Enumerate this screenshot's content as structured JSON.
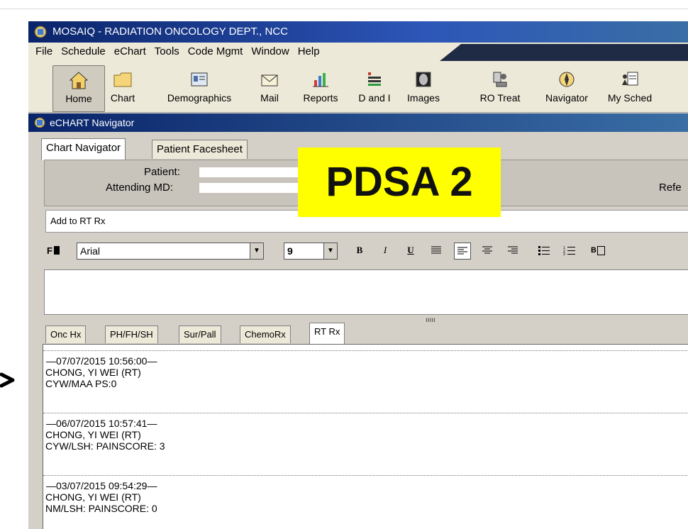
{
  "app": {
    "title": "MOSAIQ - RADIATION ONCOLOGY DEPT., NCC",
    "menu": [
      "File",
      "Schedule",
      "eChart",
      "Tools",
      "Code Mgmt",
      "Window",
      "Help"
    ]
  },
  "toolbar": {
    "items": [
      {
        "label": "Home",
        "icon": "home-icon"
      },
      {
        "label": "Chart",
        "icon": "folder-icon"
      },
      {
        "label": "Demographics",
        "icon": "id-card-icon"
      },
      {
        "label": "Mail",
        "icon": "mail-icon"
      },
      {
        "label": "Reports",
        "icon": "reports-icon"
      },
      {
        "label": "D and I",
        "icon": "d-and-i-icon"
      },
      {
        "label": "Images",
        "icon": "images-icon"
      },
      {
        "label": "RO Treat",
        "icon": "ro-treat-icon"
      },
      {
        "label": "Navigator",
        "icon": "navigator-icon"
      },
      {
        "label": "My Sched",
        "icon": "my-sched-icon"
      }
    ]
  },
  "navigator": {
    "title": "eCHART Navigator",
    "tabs": [
      "Chart Navigator",
      "Patient Facesheet"
    ],
    "patient_label": "Patient:",
    "attending_label": "Attending MD:",
    "referring_label": "Refe"
  },
  "editor": {
    "add_to_label": "Add to RT Rx",
    "font_style_button": "F",
    "font_name": "Arial",
    "font_size": "9",
    "format_buttons": [
      "bold-icon",
      "italic-icon",
      "underline-icon",
      "justify-icon",
      "align-left-icon",
      "align-center-icon",
      "align-right-icon",
      "bullet-list-icon",
      "numbered-list-icon",
      "border-icon"
    ]
  },
  "section_tabs": [
    "Onc Hx",
    "PH/FH/SH",
    "Sur/Pall",
    "ChemoRx",
    "RT Rx"
  ],
  "notes": [
    {
      "header": "—07/07/2015 10:56:00—",
      "author": "CHONG, YI WEI (RT)",
      "text": "CYW/MAA PS:0"
    },
    {
      "header": "—06/07/2015 10:57:41—",
      "author": "CHONG, YI WEI (RT)",
      "text": "CYW/LSH: PAINSCORE: 3"
    },
    {
      "header": "—03/07/2015 09:54:29—",
      "author": "CHONG, YI WEI (RT)",
      "text": "NM/LSH: PAINSCORE: 0"
    }
  ],
  "overlay_label": "PDSA 2",
  "colors": {
    "titlebar": "#0a246a",
    "highlight": "#ffff00",
    "window_bg": "#d4d0c8"
  }
}
